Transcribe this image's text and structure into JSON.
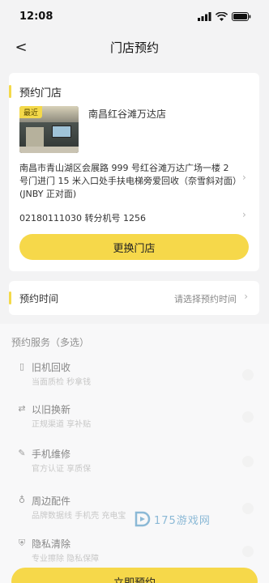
{
  "status_bar": {
    "time": "12:08"
  },
  "nav": {
    "back_glyph": "<",
    "title": "门店预约"
  },
  "store_card": {
    "heading": "预约门店",
    "badge": "最近",
    "name": "南昌红谷滩万达店",
    "address": "南昌市青山湖区会展路 999 号红谷滩万达广场一楼 2 号门进门 15 米入口处手扶电梯旁爱回收（奈雪斜对面）(JNBY 正对面)",
    "phone": "02180111030 转分机号 1256",
    "change_button": "更换门店",
    "image_icon": "store-photo"
  },
  "time_card": {
    "label": "预约时间",
    "placeholder": "请选择预约时间"
  },
  "services": {
    "title": "预约服务（多选）",
    "items": [
      {
        "name": "旧机回收",
        "desc": "当面质检 秒拿钱",
        "icon": "phone-icon"
      },
      {
        "name": "以旧换新",
        "desc": "正规渠道 享补贴",
        "icon": "swap-icon"
      },
      {
        "name": "手机维修",
        "desc": "官方认证 享质保",
        "icon": "wrench-icon"
      },
      {
        "name": "周边配件",
        "desc": "品牌数据线 手机壳 充电宝",
        "icon": "accessory-icon"
      },
      {
        "name": "隐私清除",
        "desc": "专业擦除 隐私保障",
        "icon": "shield-icon"
      }
    ]
  },
  "watermark": {
    "text": "175游戏网"
  },
  "book_button": "立即预约",
  "colors": {
    "accent": "#f6d84a",
    "background": "#f3f3f4",
    "card": "#ffffff"
  }
}
